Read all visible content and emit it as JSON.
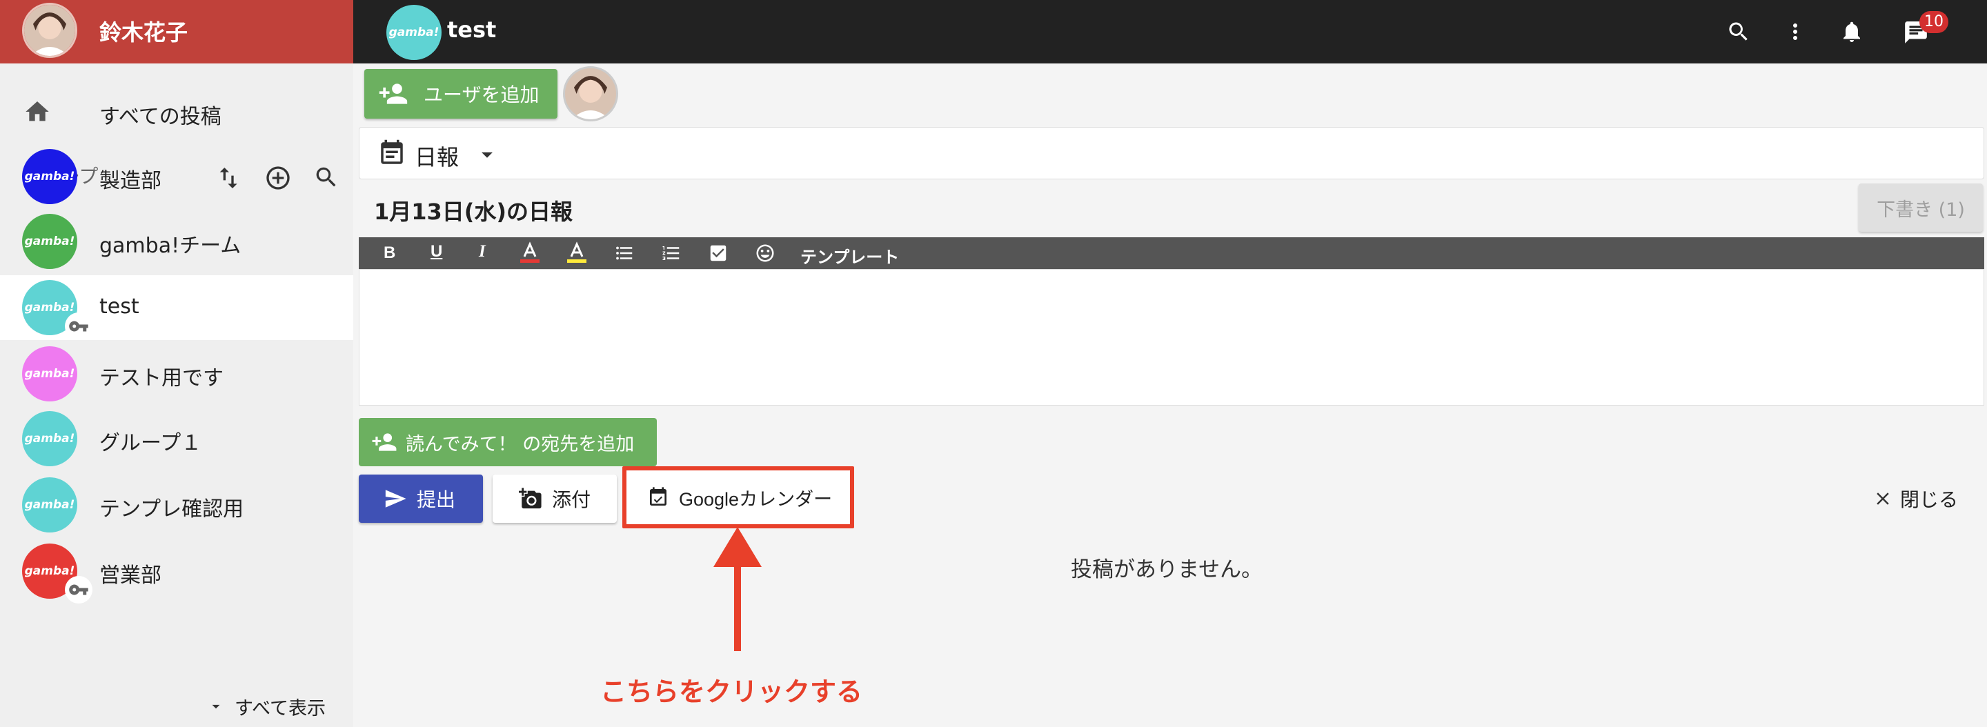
{
  "user": {
    "name": "鈴木花子"
  },
  "group_header": {
    "title": "test",
    "logo_text": "gamba!"
  },
  "topbar": {
    "notification_count": "10"
  },
  "sidebar": {
    "all_posts_label": "すべての投稿",
    "group_section_label": "グループ",
    "show_all_label": "すべて表示",
    "groups": [
      {
        "name": "製造部",
        "logo": "gamba!",
        "color": "#1a1ae6"
      },
      {
        "name": "gamba!チーム",
        "logo": "gamba!",
        "color": "#4caf50"
      },
      {
        "name": "test",
        "logo": "gamba!",
        "color": "#5fd3d3",
        "selected": true,
        "key": true
      },
      {
        "name": "テスト用です",
        "logo": "gamba!",
        "color": "#ef7af0"
      },
      {
        "name": "グループ１",
        "logo": "gamba!",
        "color": "#5fd3d3"
      },
      {
        "name": "テンプレ確認用",
        "logo": "gamba!",
        "color": "#5fd3d3"
      },
      {
        "name": "営業部",
        "logo": "gamba!",
        "color": "#e53935",
        "key": true
      }
    ]
  },
  "main": {
    "add_user_label": "ユーザを追加",
    "report_type": "日報",
    "report_title": "1月13日(水)の日報",
    "draft_label": "下書き (1)",
    "toolbar": {
      "template_label": "テンプレート"
    },
    "add_recipient_label": "読んでみて！ の宛先を追加",
    "submit_label": "提出",
    "attach_label": "添付",
    "calendar_label": "Googleカレンダー",
    "close_label": "閉じる",
    "empty_message": "投稿がありません。",
    "annotation": "こちらをクリックする"
  },
  "colors": {
    "sidebar_header": "#c0413a",
    "topbar": "#222222",
    "accent_green": "#6cb060",
    "submit_blue": "#3f51b5",
    "annotation_red": "#e8402a",
    "editor_toolbar": "#555555"
  }
}
